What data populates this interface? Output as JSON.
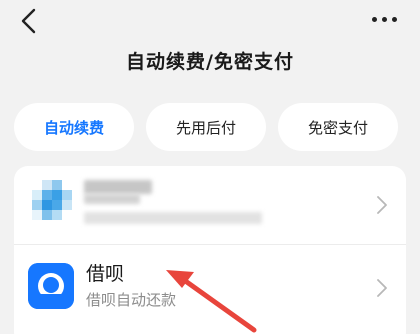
{
  "header": {
    "title": "自动续费/免密支付",
    "back_icon": "chevron-left-icon",
    "more_icon": "more-horizontal-icon"
  },
  "tabs": [
    {
      "label": "自动续费",
      "active": true
    },
    {
      "label": "先用后付",
      "active": false
    },
    {
      "label": "免密支付",
      "active": false
    }
  ],
  "services": [
    {
      "title": "",
      "subtitle": "",
      "blurred": true,
      "icon": "pixelated-app-icon"
    },
    {
      "title": "借呗",
      "subtitle": "借呗自动还款",
      "blurred": false,
      "icon": "jiebei-icon"
    }
  ],
  "colors": {
    "accent": "#1677ff",
    "background": "#f2f2f2",
    "annotation": "#e8453c"
  }
}
